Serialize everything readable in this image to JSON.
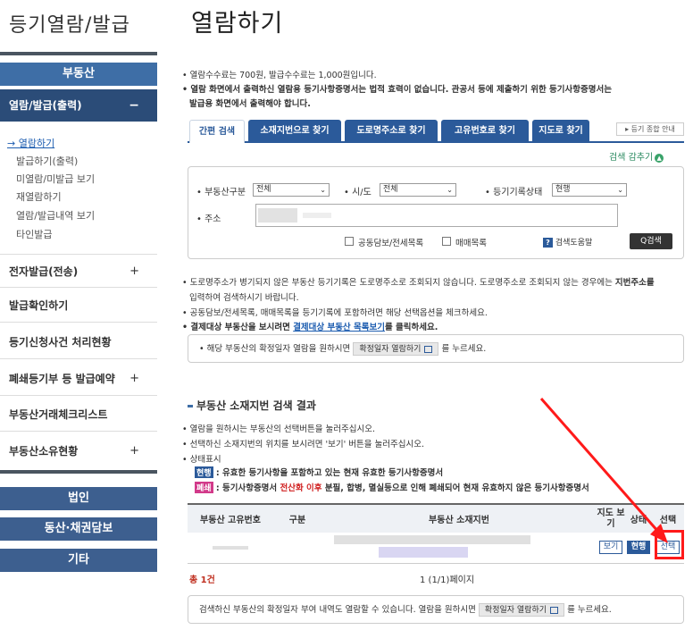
{
  "sidebar": {
    "title": "등기열람/발급",
    "main_label": "부동산",
    "section_label": "열람/발급(출력)",
    "section_sign": "−",
    "sub_items": [
      "→ 열람하기",
      "발급하기(출력)",
      "미열람/미발급 보기",
      "재열람하기",
      "열람/발급내역 보기",
      "타인발급"
    ],
    "menu_items": [
      {
        "label": "전자발급(전송)",
        "sign": "+"
      },
      {
        "label": "발급확인하기",
        "sign": ""
      },
      {
        "label": "등기신청사건 처리현황",
        "sign": ""
      },
      {
        "label": "폐쇄등기부 등 발급예약",
        "sign": "+"
      },
      {
        "label": "부동산거래체크리스트",
        "sign": ""
      },
      {
        "label": "부동산소유현황",
        "sign": "+"
      }
    ],
    "buttons": [
      "법인",
      "동산·채권담보",
      "기타"
    ]
  },
  "main": {
    "title": "열람하기",
    "notes": [
      "• 열람수수료는 700원, 발급수수료는 1,000원입니다.",
      "• 열람 화면에서 출력하신 열람용 등기사항증명서는 법적 효력이 없습니다. 관공서 등에 제출하기 위한 등기사항증명서는",
      "발급용 화면에서 출력해야 합니다."
    ],
    "tabs": [
      "간편 검색",
      "소재지번으로 찾기",
      "도로명주소로 찾기",
      "고유번호로 찾기",
      "지도로 찾기"
    ],
    "guide_button": "▸ 등기 종합 안내",
    "collapse_label": "검색 감추기",
    "collapse_icon": "up-chevron-icon",
    "form": {
      "type_label": "• 부동산구분",
      "type_value": "전체",
      "sido_label": "• 시/도",
      "sido_value": "전체",
      "status_label": "• 등기기록상태",
      "status_value": "현행",
      "addr_label": "• 주소",
      "chk1": "공동담보/전세목록",
      "chk2": "매매목록",
      "help_label": "검색도움말",
      "help_icon": "?",
      "search_label": "Q검색"
    },
    "info": [
      "• 도로명주소가 병기되지 않은 부동산 등기기록은 도로명주소로 조회되지 않습니다. 도로명주소로 조회되지 않는 경우에는",
      "지번주소를",
      "입력하여 검색하시기 바랍니다.",
      "• 공동담보/전세목록, 매매목록을 등기기록에 포함하려면 해당 선택옵션을 체크하세요.",
      "• 결제대상 부동산을 보시려면",
      "결제대상 부동산 목록보기",
      "를 클릭하세요."
    ],
    "date_box": {
      "prefix": "• 해당 부동산의 확정일자 열람을 원하시면",
      "button": "확정일자 열람하기",
      "suffix": "를 누르세요."
    },
    "results": {
      "title": "부동산 소재지번 검색 결과",
      "notes": [
        "• 열람을 원하시는 부동산의 선택버튼을 눌러주십시오.",
        "• 선택하신 소재지번의 위치를 보시려면 '보기' 버튼을 눌러주십시오.",
        "• 상태표시"
      ],
      "legend1_badge": "현행",
      "legend1_text": ": 유효한 등기사항을 포함하고 있는 현재 유효한 등기사항증명서",
      "legend2_badge": "폐쇄",
      "legend2_pre": ": 등기사항증명서",
      "legend2_red": "전산화 이후",
      "legend2_post": "분필, 합병, 멸실등으로 인해 폐쇄되어 현재 유효하지 않은 등기사항증명서",
      "columns": [
        "부동산 고유번호",
        "구분",
        "부동산 소재지번",
        "지도 보기",
        "상태",
        "선택"
      ],
      "row": {
        "map": "보기",
        "status": "현행",
        "select": "선택"
      },
      "total": "총 1건",
      "paging": "1 (1/1)페이지"
    },
    "footer": {
      "prefix": "검색하신 부동산의 확정일자 부여 내역도 열람할 수 있습니다. 열람을 원하시면",
      "button": "확정일자 열람하기",
      "suffix": "를 누르세요."
    }
  },
  "colors": {
    "primary": "#2b5a9a",
    "sidebar": "#3e6ea6",
    "accent_red": "#ff1a1a"
  }
}
